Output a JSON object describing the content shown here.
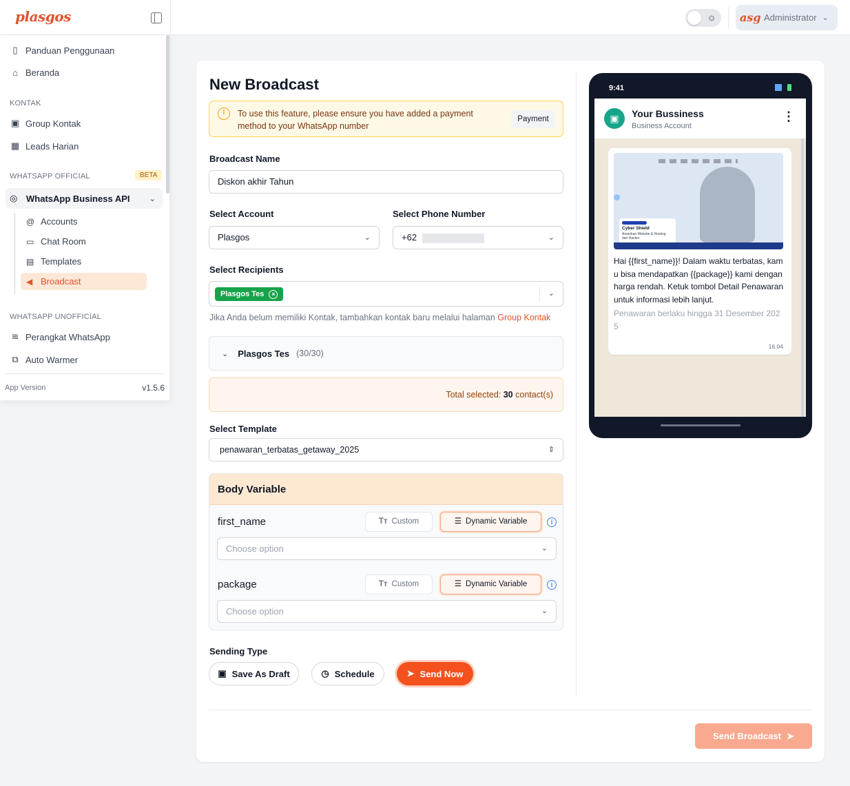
{
  "brand": {
    "logo_text": "plasgos"
  },
  "topbar": {
    "user_avatar_text": "asgos",
    "user_name": "Administrator"
  },
  "sidebar": {
    "items_top": [
      {
        "label": "Panduan Penggunaan",
        "icon": "book-icon"
      },
      {
        "label": "Beranda",
        "icon": "home-icon"
      }
    ],
    "section_kontak": "KONTAK",
    "kontak_items": [
      {
        "label": "Group Kontak",
        "icon": "contact-icon"
      },
      {
        "label": "Leads Harian",
        "icon": "calendar-icon"
      }
    ],
    "section_official": "WHATSAPP OFFICIAL",
    "beta_badge": "BETA",
    "api_item": "WhatsApp Business API",
    "sub_items": [
      {
        "label": "Accounts",
        "icon": "at-icon"
      },
      {
        "label": "Chat Room",
        "icon": "chat-icon"
      },
      {
        "label": "Templates",
        "icon": "template-icon"
      },
      {
        "label": "Broadcast",
        "icon": "megaphone-icon",
        "active": true
      }
    ],
    "section_unofficial": "WHATSAPP UNOFFICIAL",
    "unofficial_items": [
      {
        "label": "Perangkat WhatsApp",
        "icon": "wifi-icon"
      },
      {
        "label": "Auto Warmer",
        "icon": "warmer-icon"
      }
    ],
    "app_version_label": "App Version",
    "app_version_value": "v1.5.6"
  },
  "form": {
    "title": "New Broadcast",
    "alert_text": "To use this feature, please ensure you have added a payment method to your WhatsApp number",
    "alert_button": "Payment",
    "broadcast_name_label": "Broadcast Name",
    "broadcast_name_value": "Diskon akhir Tahun",
    "select_account_label": "Select Account",
    "select_account_value": "Plasgos",
    "select_phone_label": "Select Phone Number",
    "select_phone_value": "+62",
    "select_recipients_label": "Select Recipients",
    "recipient_tag": "Plasgos Tes",
    "hint_text": "Jika Anda belum memiliki Kontak, tambahkan kontak baru melalui halaman ",
    "hint_link": "Group Kontak",
    "group_name": "Plasgos Tes",
    "group_count": "(30/30)",
    "total_label": "Total selected: ",
    "total_count": "30",
    "total_suffix": " contact(s)",
    "select_template_label": "Select Template",
    "select_template_value": "penawaran_terbatas_getaway_2025",
    "body_variable_title": "Body Variable",
    "variables": [
      {
        "name": "first_name",
        "custom_label": "Custom",
        "dynamic_label": "Dynamic Variable",
        "placeholder": "Choose option"
      },
      {
        "name": "package",
        "custom_label": "Custom",
        "dynamic_label": "Dynamic Variable",
        "placeholder": "Choose option"
      }
    ],
    "sending_type_label": "Sending Type",
    "save_draft_label": "Save As Draft",
    "schedule_label": "Schedule",
    "send_now_label": "Send Now",
    "send_broadcast_label": "Send Broadcast"
  },
  "preview": {
    "status_time": "9:41",
    "business_name": "Your Bussiness",
    "business_sub": "Business Account",
    "media_title": "Cyber Shield",
    "media_sub": "Amankan Website & Hosting dari Hacker",
    "message": "Hai {{first_name}}! Dalam waktu terbatas, kamu bisa mendapatkan {{package}} kami dengan harga rendah. Ketuk tombol Detail Penawaran untuk informasi lebih lanjut.",
    "footer": "Penawaran berlaku hingga 31 Desember 2025",
    "time": "16.04"
  }
}
